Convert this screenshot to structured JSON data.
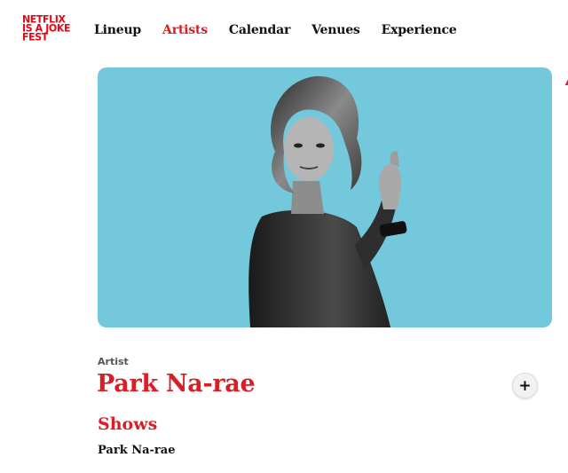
{
  "logo": {
    "lines": [
      "NETFLIX",
      "IS A JOKE",
      "FEST"
    ]
  },
  "nav": {
    "items": [
      {
        "label": "Lineup"
      },
      {
        "label": "Artists",
        "active": true
      },
      {
        "label": "Calendar"
      },
      {
        "label": "Venues"
      },
      {
        "label": "Experience"
      }
    ]
  },
  "hero": {
    "background": "#73c8dc"
  },
  "artist": {
    "kicker": "Artist",
    "name": "Park Na-rae",
    "follow_icon": "plus-icon"
  },
  "shows": {
    "title": "Shows",
    "items": [
      {
        "label": "Park Na-rae"
      }
    ]
  },
  "colors": {
    "accent": "#d81f26",
    "text": "#111111"
  }
}
